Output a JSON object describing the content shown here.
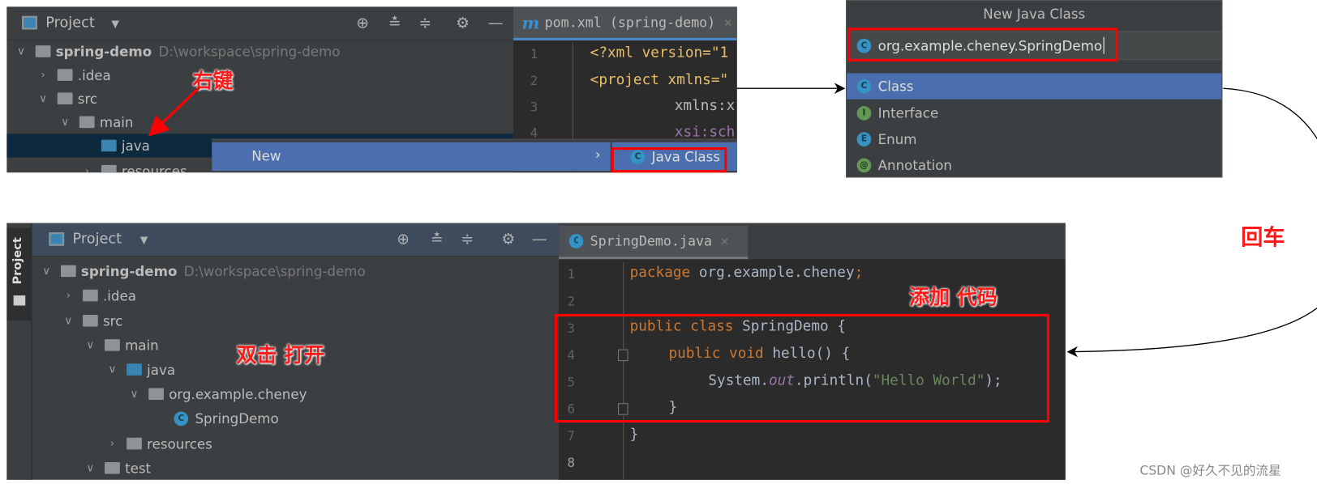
{
  "top_ide": {
    "panel_title": "Project",
    "tree": [
      {
        "label": "spring-demo",
        "path": "D:\\workspace\\spring-demo"
      },
      {
        "label": ".idea"
      },
      {
        "label": "src"
      },
      {
        "label": "main"
      },
      {
        "label": "java"
      },
      {
        "label": "resources"
      }
    ],
    "tab": {
      "file_label": "pom.xml (spring-demo)",
      "file_icon": "maven-m-icon",
      "close": "×"
    },
    "lines": [
      "1",
      "2",
      "3",
      "4"
    ],
    "code": [
      "<?xml version=\"1",
      "<project xmlns=\"",
      "xmlns:x",
      "xsi:sch"
    ],
    "context_menu": {
      "item": "New",
      "submenu_item": "Java Class"
    },
    "annotation": "右键"
  },
  "dialog": {
    "title": "New Java Class",
    "input_value": "org.example.cheney.SpringDemo",
    "options": [
      {
        "label": "Class",
        "icon": "C",
        "selected": true
      },
      {
        "label": "Interface",
        "icon": "I"
      },
      {
        "label": "Enum",
        "icon": "E"
      },
      {
        "label": "Annotation",
        "icon": "@"
      }
    ],
    "annotation": "回车"
  },
  "bottom_ide": {
    "side_tab": "Project",
    "panel_title": "Project",
    "tree": [
      {
        "label": "spring-demo",
        "path": "D:\\workspace\\spring-demo"
      },
      {
        "label": ".idea"
      },
      {
        "label": "src"
      },
      {
        "label": "main"
      },
      {
        "label": "java"
      },
      {
        "label": "org.example.cheney"
      },
      {
        "label": "SpringDemo"
      },
      {
        "label": "resources"
      },
      {
        "label": "test"
      }
    ],
    "tab": {
      "file_label": "SpringDemo.java",
      "close": "×"
    },
    "lines": [
      "1",
      "2",
      "3",
      "4",
      "5",
      "6",
      "7",
      "8"
    ],
    "code": {
      "l1_kw": "package",
      "l1_rest": " org.example.cheney",
      "l3_kw": "public class",
      "l3_rest": " SpringDemo {",
      "l4_kw": "public void",
      "l4_rest": " hello() {",
      "l5_a": "System.",
      "l5_field": "out",
      "l5_b": ".println(",
      "l5_str": "\"Hello World\"",
      "l5_c": ");",
      "l6": "}",
      "l7": "}",
      "semicolon": ";"
    },
    "annotation_open": "双击 打开",
    "annotation_code": "添加 代码"
  },
  "watermark": "CSDN @好久不见的流星",
  "colors": {
    "selection": "#4b6eaf",
    "tree_selection": "#0d293e",
    "annotation": "#ff0000",
    "keyword": "#cc7832",
    "string": "#6a8759"
  }
}
